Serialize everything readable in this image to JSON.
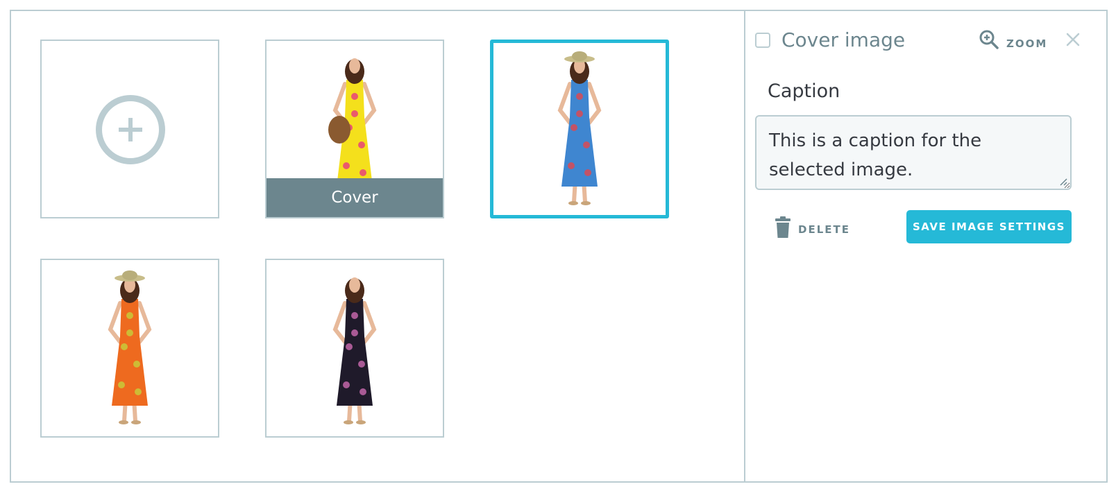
{
  "gallery": {
    "add_button": {
      "icon": "add-circle-icon"
    },
    "images": [
      {
        "id": "img-yellow",
        "dress": "#f4e01c",
        "flower": "#e8427a",
        "cover": true,
        "selected": false,
        "hat": false,
        "bag": true
      },
      {
        "id": "img-blue",
        "dress": "#3f86d0",
        "flower": "#d94a55",
        "cover": false,
        "selected": true,
        "hat": true,
        "bag": false
      },
      {
        "id": "img-orange",
        "dress": "#ee6a1f",
        "flower": "#c8c93a",
        "cover": false,
        "selected": false,
        "hat": true,
        "bag": false
      },
      {
        "id": "img-black",
        "dress": "#1f1a2a",
        "flower": "#c266a8",
        "cover": false,
        "selected": false,
        "hat": false,
        "bag": false
      }
    ],
    "cover_label": "Cover"
  },
  "settings": {
    "cover_checkbox_label": "Cover image",
    "cover_checked": false,
    "zoom_label": "ZOOM",
    "caption_label": "Caption",
    "caption_value": "This is a caption for the selected image.",
    "delete_label": "DELETE",
    "save_label": "SAVE IMAGE SETTINGS"
  },
  "colors": {
    "accent": "#25b9d7",
    "border": "#bbcdd2",
    "muted": "#6c868e",
    "text": "#363a41"
  }
}
